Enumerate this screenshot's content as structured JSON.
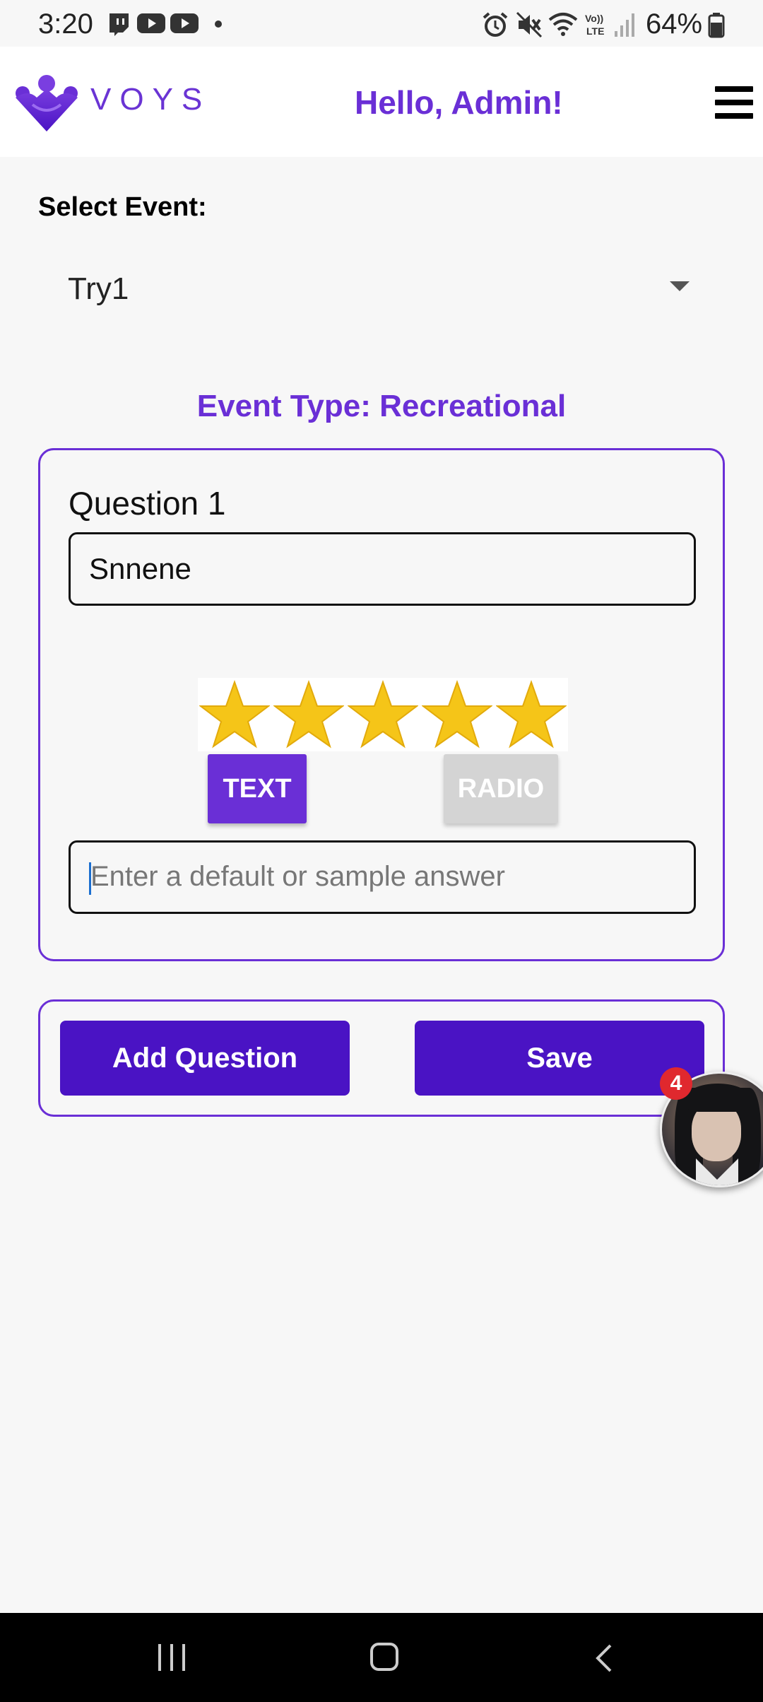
{
  "status_bar": {
    "time": "3:20",
    "battery": "64%",
    "icons": [
      "twitch-icon",
      "youtube-icon",
      "youtube-icon",
      "dot-icon",
      "alarm-icon",
      "mute-icon",
      "wifi-icon",
      "volte-icon",
      "signal-icon",
      "battery-icon"
    ]
  },
  "header": {
    "logo_text": "VOYS",
    "greeting": "Hello, Admin!",
    "brand_color": "#6a2fd6"
  },
  "event_select": {
    "label": "Select Event:",
    "selected": "Try1"
  },
  "event_type": "Event Type: Recreational",
  "question": {
    "label": "Question 1",
    "value": "Snnene",
    "rating_stars": 5,
    "star_color": "#f5c518",
    "type_buttons": {
      "text": "TEXT",
      "radio": "RADIO",
      "active": "TEXT"
    },
    "answer_placeholder": "Enter a default or sample answer"
  },
  "actions": {
    "add_question": "Add Question",
    "save": "Save",
    "button_color": "#4a13c4"
  },
  "chat_head": {
    "badge_count": "4"
  }
}
